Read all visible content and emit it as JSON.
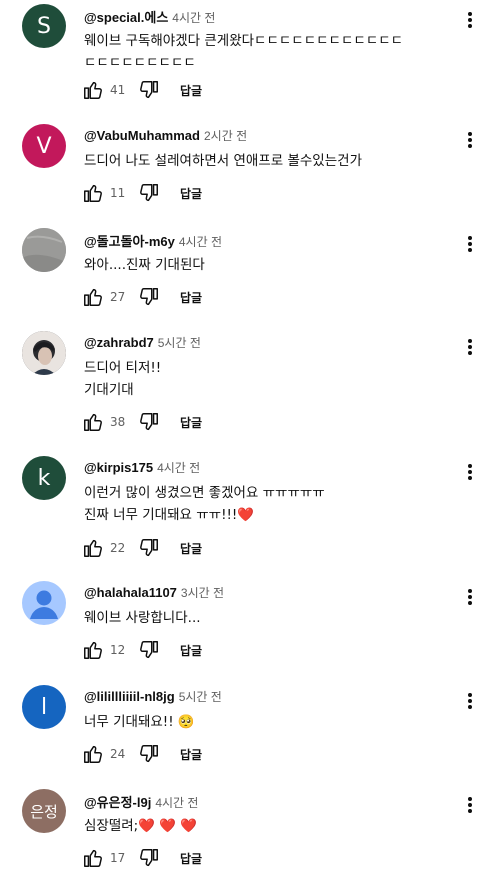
{
  "reply_label": "답글",
  "comments": [
    {
      "author": "@special.에스",
      "time": "4시간 전",
      "lines": [
        "웨이브 구독해야겠다 큰게왔다ㄷㄷㄷㄷㄷㄷㄷㄷㄷㄷㄷㄷ",
        "ㄷㄷㄷㄷㄷㄷㄷㄷㄷ"
      ],
      "likes": "41",
      "avatar": {
        "type": "letter",
        "letter": "S",
        "color": "#1f4d3a"
      }
    },
    {
      "author": "@VabuMuhammad",
      "time": "2시간 전",
      "lines": [
        "드디어 나도 설레여하면서 연애프로 볼수있는건가"
      ],
      "likes": "11",
      "avatar": {
        "type": "letter",
        "letter": "V",
        "color": "#c2185b"
      }
    },
    {
      "author": "@돌고돌아-m6y",
      "time": "4시간 전",
      "lines": [
        "와아....진짜 기대된다"
      ],
      "likes": "27",
      "avatar": {
        "type": "photo",
        "color": "#9e9e9e"
      }
    },
    {
      "author": "@zahrabd7",
      "time": "5시간 전",
      "lines": [
        "드디어 티저!!",
        "기대기대"
      ],
      "likes": "38",
      "avatar": {
        "type": "photo",
        "color": "#3b3f46"
      }
    },
    {
      "author": "@kirpis175",
      "time": "4시간 전",
      "lines": [
        "이런거 많이 생겼으면 좋겠어요 ㅠㅠㅠㅠㅠ",
        "진짜 너무 기대돼요 ㅠㅠ!!!❤️"
      ],
      "likes": "22",
      "avatar": {
        "type": "letter",
        "letter": "k",
        "color": "#1f4d3a"
      }
    },
    {
      "author": "@halahala1107",
      "time": "3시간 전",
      "lines": [
        "웨이브 사랑합니다..."
      ],
      "likes": "12",
      "avatar": {
        "type": "default",
        "color": "#a6c8ff"
      }
    },
    {
      "author": "@lilillliiiil-nl8jg",
      "time": "5시간 전",
      "lines": [
        "너무 기대돼요!! 🥺"
      ],
      "likes": "24",
      "avatar": {
        "type": "letter",
        "letter": "l",
        "color": "#1565c0"
      }
    },
    {
      "author": "@유은정-l9j",
      "time": "4시간 전",
      "lines": [
        "심장떨려;❤️ ❤️ ❤️"
      ],
      "likes": "17",
      "avatar": {
        "type": "letter",
        "letter": "은정",
        "color": "#8d6e63"
      }
    }
  ]
}
